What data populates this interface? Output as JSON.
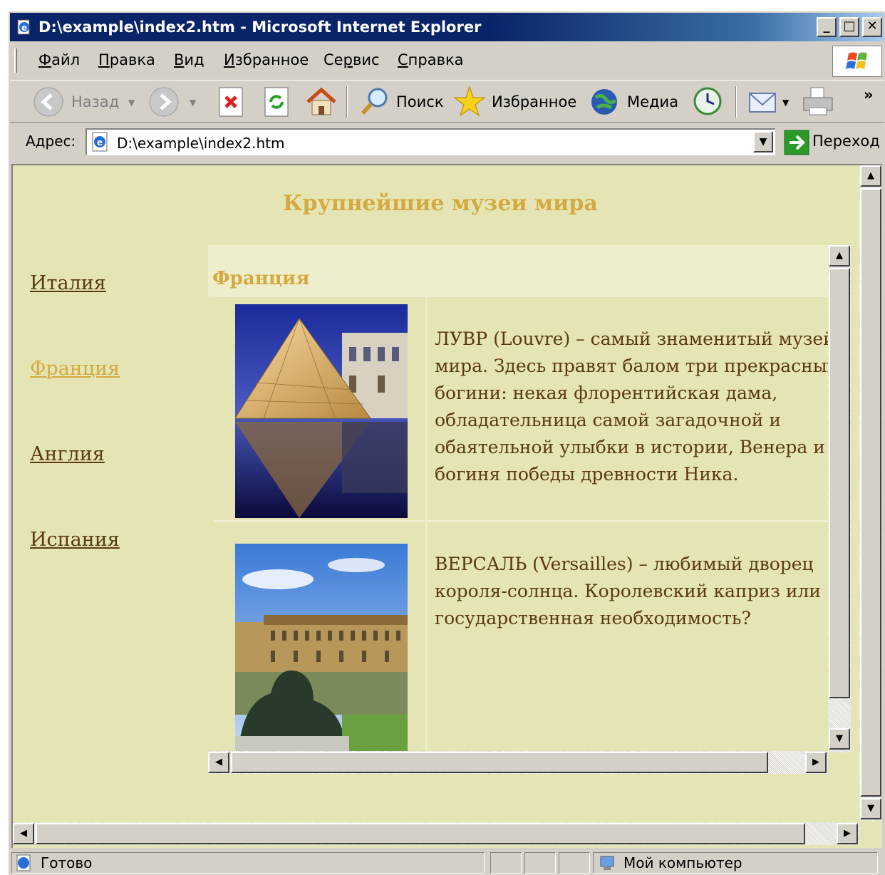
{
  "window": {
    "title": "D:\\example\\index2.htm - Microsoft Internet Explorer",
    "minimize": "_",
    "maximize": "□",
    "close": "✕"
  },
  "menu": {
    "items": [
      {
        "u": "Ф",
        "rest": "айл"
      },
      {
        "u": "П",
        "rest": "равка"
      },
      {
        "u": "В",
        "rest": "ид"
      },
      {
        "u": "И",
        "rest": "збранное"
      },
      {
        "pre": "Се",
        "u": "р",
        "rest": "вис"
      },
      {
        "u": "С",
        "rest": "правка"
      }
    ]
  },
  "toolbar": {
    "back": "Назад",
    "search": "Поиск",
    "favorites": "Избранное",
    "media": "Медиа",
    "more": "»"
  },
  "address": {
    "label": "Адрес:",
    "value": "D:\\example\\index2.htm",
    "go": "Переход"
  },
  "page": {
    "title": "Крупнейшие музеи мира",
    "nav": [
      "Италия",
      "Франция",
      "Англия",
      "Испания"
    ],
    "frame_heading": "Франция",
    "museums": [
      {
        "text": "ЛУВР (Louvre) – самый знаменитый музей\nмира. Здесь правят балом три прекрасных\nбогини: некая флорентийская дама,\nобладательница самой загадочной и\nобаятельной улыбки в истории, Венера и\nбогиня победы древности Ника."
      },
      {
        "text": "ВЕРСАЛЬ (Versailles) – любимый дворец\nкороля-солнца. Королевский каприз или\nгосударственная необходимость?"
      }
    ]
  },
  "status": {
    "text": "Готово",
    "zone": "Мой компьютер"
  },
  "colors": {
    "page_bg": "#e4e4b4",
    "accent": "#d4aa40",
    "link": "#5a3a10",
    "titlebar": "#0a246a"
  }
}
